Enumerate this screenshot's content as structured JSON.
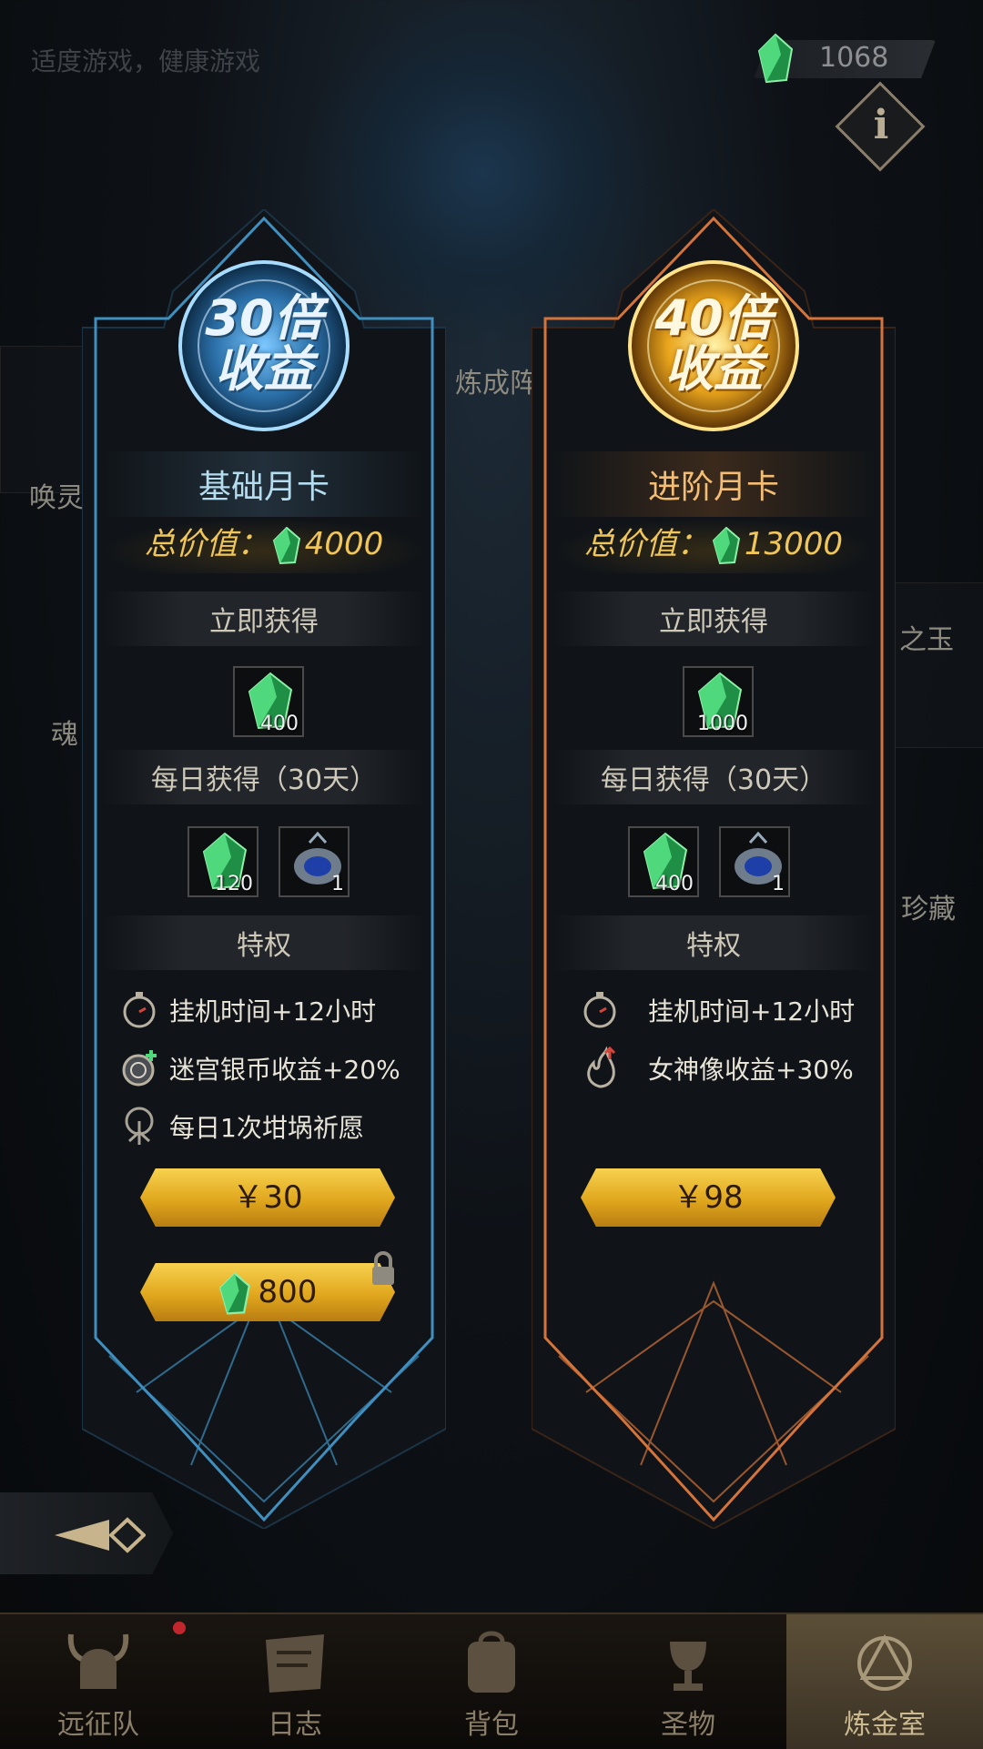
{
  "header": {
    "notice": "适度游戏，健康游戏",
    "currency_value": "1068"
  },
  "background_labels": {
    "left_1": "唤灵",
    "left_2": "魂",
    "mid": "炼成阵",
    "right_1": "之玉",
    "right_2": "珍藏"
  },
  "cards": [
    {
      "emblem_line1": "30倍",
      "emblem_line2": "收益",
      "title": "基础月卡",
      "total_label": "总价值：",
      "total_value": "4000",
      "instant_head": "立即获得",
      "instant_items": [
        {
          "icon": "green-gem",
          "count": "400"
        }
      ],
      "daily_head": "每日获得（30天）",
      "daily_items": [
        {
          "icon": "green-gem",
          "count": "120"
        },
        {
          "icon": "blue-ore",
          "count": "1"
        }
      ],
      "priv_head": "特权",
      "privileges": [
        {
          "icon": "stopwatch-icon",
          "text": "挂机时间+12小时"
        },
        {
          "icon": "silver-coin-plus-icon",
          "text": "迷宫银币收益+20%"
        },
        {
          "icon": "tree-icon",
          "text": "每日1次坩埚祈愿"
        }
      ],
      "price_label": "￥30",
      "gem_price_label": "800"
    },
    {
      "emblem_line1": "40倍",
      "emblem_line2": "收益",
      "title": "进阶月卡",
      "total_label": "总价值：",
      "total_value": "13000",
      "instant_head": "立即获得",
      "instant_items": [
        {
          "icon": "green-gem",
          "count": "1000"
        }
      ],
      "daily_head": "每日获得（30天）",
      "daily_items": [
        {
          "icon": "green-gem",
          "count": "400"
        },
        {
          "icon": "blue-ore",
          "count": "1"
        }
      ],
      "priv_head": "特权",
      "privileges": [
        {
          "icon": "stopwatch-icon",
          "text": "挂机时间+12小时"
        },
        {
          "icon": "flame-arrow-icon",
          "text": "女神像收益+30%"
        }
      ],
      "price_label": "￥98"
    }
  ],
  "bottom_nav": [
    {
      "label": "远征队",
      "icon": "horned-helmet-icon"
    },
    {
      "label": "日志",
      "icon": "scroll-map-icon"
    },
    {
      "label": "背包",
      "icon": "backpack-icon"
    },
    {
      "label": "圣物",
      "icon": "chalice-icon"
    },
    {
      "label": "炼金室",
      "icon": "alchemy-icon"
    }
  ],
  "colors": {
    "basic_accent": "#3f8fbf",
    "advanced_accent": "#d4733a",
    "gem_green": "#2fbf5a",
    "gold_button": "#e8b62a"
  }
}
